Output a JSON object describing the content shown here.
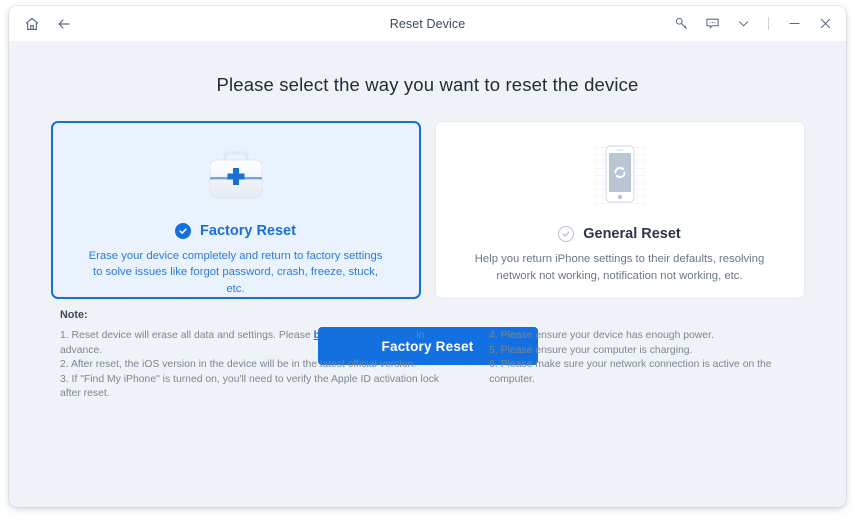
{
  "window": {
    "title": "Reset Device",
    "left_icons": [
      {
        "name": "home-icon"
      },
      {
        "name": "back-arrow-icon"
      }
    ],
    "right_icons": [
      {
        "name": "key-icon"
      },
      {
        "name": "feedback-icon"
      },
      {
        "name": "chevron-down-icon"
      },
      {
        "name": "minimize-icon"
      },
      {
        "name": "close-icon"
      }
    ]
  },
  "main": {
    "heading": "Please select the way you want to reset the device",
    "cards": [
      {
        "id": "factory-reset",
        "title": "Factory Reset",
        "description": "Erase your device completely and return to factory settings to solve issues like forgot password, crash, freeze, stuck, etc.",
        "selected": true,
        "art_icon": "first-aid-kit-icon"
      },
      {
        "id": "general-reset",
        "title": "General Reset",
        "description": "Help you return iPhone settings to their defaults, resolving network not working, notification not working, etc.",
        "selected": false,
        "art_icon": "phone-refresh-icon"
      }
    ],
    "primary_button": "Factory Reset"
  },
  "notes": {
    "label": "Note:",
    "left": [
      {
        "before": "1. Reset device will erase all data and settings. Please ",
        "link": "back up your device",
        "after": " in advance."
      },
      {
        "before": "2. After reset, the iOS version in the device will be in the latest official version.",
        "link": "",
        "after": ""
      },
      {
        "before": "3. If \"Find My iPhone\" is turned on, you'll need to verify the Apple ID activation lock after reset.",
        "link": "",
        "after": ""
      }
    ],
    "right": [
      "4. Please ensure your device has enough power.",
      "5. Please ensure your computer is charging.",
      "6. Please make sure your network connection is active on the computer."
    ]
  },
  "colors": {
    "accent": "#1270e0",
    "selected_border": "#1b6fd4",
    "selected_bg": "#eaf3fd",
    "page_bg": "#eff3f7",
    "muted_text": "#7b8696"
  }
}
